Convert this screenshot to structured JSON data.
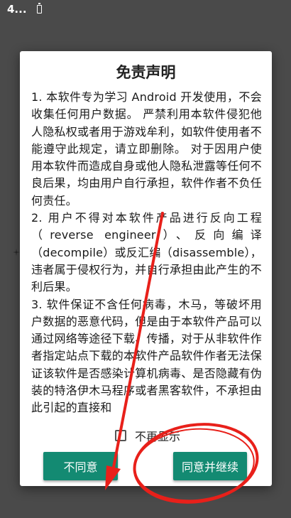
{
  "status_bar": {
    "time": "4...",
    "battery_icon": "battery-icon"
  },
  "dialog": {
    "title": "免责声明",
    "paragraphs": [
      "1. 本软件专为学习 Android 开发使用，不会收集任何用户数据。 严禁利用本软件侵犯他人隐私权或者用于游戏牟利，如软件使用者不能遵守此规定，请立即删除。 对于因用户使用本软件而造成自身或他人隐私泄露等任何不良后果，均由用户自行承担，软件作者不负任何责任。",
      " 2. 用户不得对本软件产品进行反向工程（reverse engineer）、反向编译（decompile）或反汇编（disassemble），违者属于侵权行为，并自行承担由此产生的不利后果。",
      " 3. 软件保证不含任何病毒，木马，等破坏用户数据的恶意代码，但是由于本软件产品可以通过网络等途径下载、传播，对于从非软件作者指定站点下载的本软件产品软件作者无法保证该软件是否感染计算机病毒、是否隐藏有伪装的特洛伊木马程序或者黑客软件，不承担由此引起的直接和"
    ],
    "checkbox_label": "不再显示",
    "checkbox_checked": false,
    "disagree_label": "不同意",
    "agree_label": "同意并继续"
  },
  "colors": {
    "button": "#138a72",
    "annotation": "#e8201a",
    "overlay": "#4a4a4a"
  }
}
